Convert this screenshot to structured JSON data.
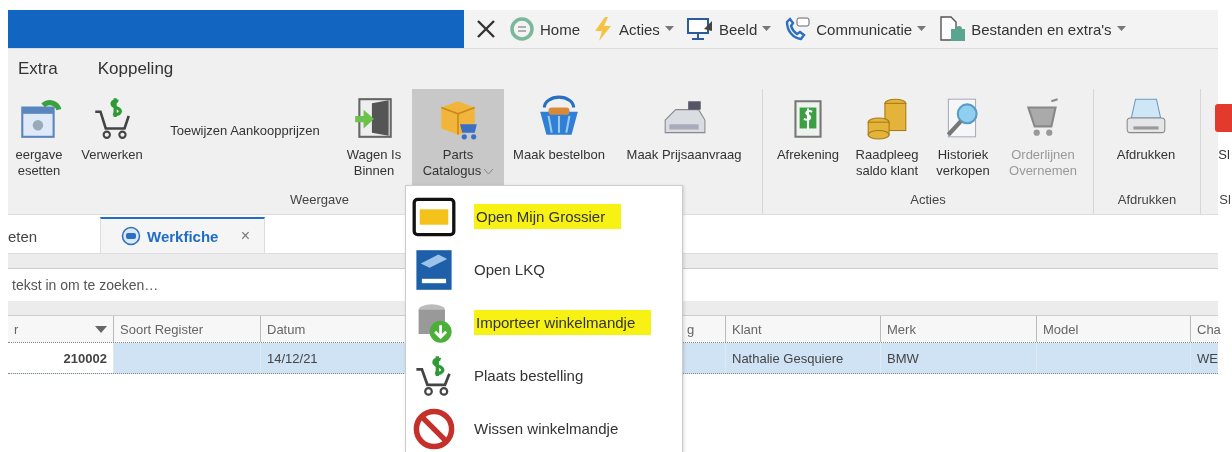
{
  "quick_toolbar": [
    {
      "kind": "close",
      "dropdown": false
    },
    {
      "label": "Home",
      "kind": "home",
      "dropdown": false
    },
    {
      "label": "Acties",
      "kind": "bolt",
      "dropdown": true
    },
    {
      "label": "Beeld",
      "kind": "screen",
      "dropdown": true
    },
    {
      "label": "Communicatie",
      "kind": "phone",
      "dropdown": true
    },
    {
      "label": "Bestanden en extra's",
      "kind": "file",
      "dropdown": true
    }
  ],
  "menu": [
    "Extra",
    "Koppeling"
  ],
  "ribbon": [
    {
      "label": "Weergave",
      "buttons": [
        {
          "label": "eergave\nesetten",
          "kind": "large",
          "selected": false,
          "disabled": false,
          "dropdown": false
        },
        {
          "label": "Verwerken",
          "kind": "large",
          "selected": false,
          "disabled": false,
          "dropdown": false
        },
        {
          "label": "Toewijzen Aankoopprijzen",
          "kind": "text",
          "selected": false,
          "disabled": false,
          "dropdown": false
        },
        {
          "label": "Wagen Is\nBinnen",
          "kind": "large",
          "selected": false,
          "disabled": false,
          "dropdown": false
        },
        {
          "label": "Parts\nCatalogus",
          "kind": "large",
          "selected": true,
          "disabled": false,
          "dropdown": true
        },
        {
          "label": "Maak bestelbon",
          "kind": "large",
          "selected": false,
          "disabled": false,
          "dropdown": false
        },
        {
          "label": "Maak Prijsaanvraag",
          "kind": "large",
          "selected": false,
          "disabled": false,
          "dropdown": false
        }
      ]
    },
    {
      "label": "Acties",
      "buttons": [
        {
          "label": "Afrekening",
          "kind": "large",
          "selected": false,
          "disabled": false,
          "dropdown": false
        },
        {
          "label": "Raadpleeg\nsaldo klant",
          "kind": "large",
          "selected": false,
          "disabled": false,
          "dropdown": false
        },
        {
          "label": "Historiek\nverkopen",
          "kind": "large",
          "selected": false,
          "disabled": false,
          "dropdown": false
        },
        {
          "label": "Orderlijnen\nOvernemen",
          "kind": "large",
          "selected": false,
          "disabled": true,
          "dropdown": false
        }
      ]
    },
    {
      "label": "Afdrukken",
      "buttons": [
        {
          "label": "Afdrukken",
          "kind": "large",
          "selected": false,
          "disabled": false,
          "dropdown": false
        }
      ]
    },
    {
      "label": "Sl",
      "buttons": [
        {
          "label": "Sl",
          "kind": "large",
          "selected": false,
          "disabled": false,
          "dropdown": false
        }
      ]
    }
  ],
  "doc_tabs": [
    {
      "label": "eten",
      "selected": false
    },
    {
      "label": "Werkfiche",
      "selected": true,
      "closable": true,
      "close": "×"
    }
  ],
  "search": {
    "placeholder": "tekst in om te zoeken…"
  },
  "grid": {
    "columns": [
      {
        "label": "r",
        "sortable": true
      },
      {
        "label": "Soort Register"
      },
      {
        "label": "Datum"
      },
      {
        "label": "g"
      },
      {
        "label": "Klant"
      },
      {
        "label": "Merk"
      },
      {
        "label": "Model"
      },
      {
        "label": "Cha"
      }
    ],
    "rows": [
      {
        "selected": true,
        "cells": [
          "210002",
          "",
          "14/12/21",
          "",
          "Nathalie Gesquiere",
          "BMW",
          "",
          "WE"
        ]
      }
    ]
  },
  "dropdown_menu": [
    {
      "label": "Open Mijn Grossier",
      "highlighted": true
    },
    {
      "label": "Open LKQ",
      "highlighted": false
    },
    {
      "label": "Importeer winkelmandje",
      "highlighted": true
    },
    {
      "label": "Plaats bestelling",
      "highlighted": false
    },
    {
      "label": "Wissen winkelmandje",
      "highlighted": false
    }
  ]
}
